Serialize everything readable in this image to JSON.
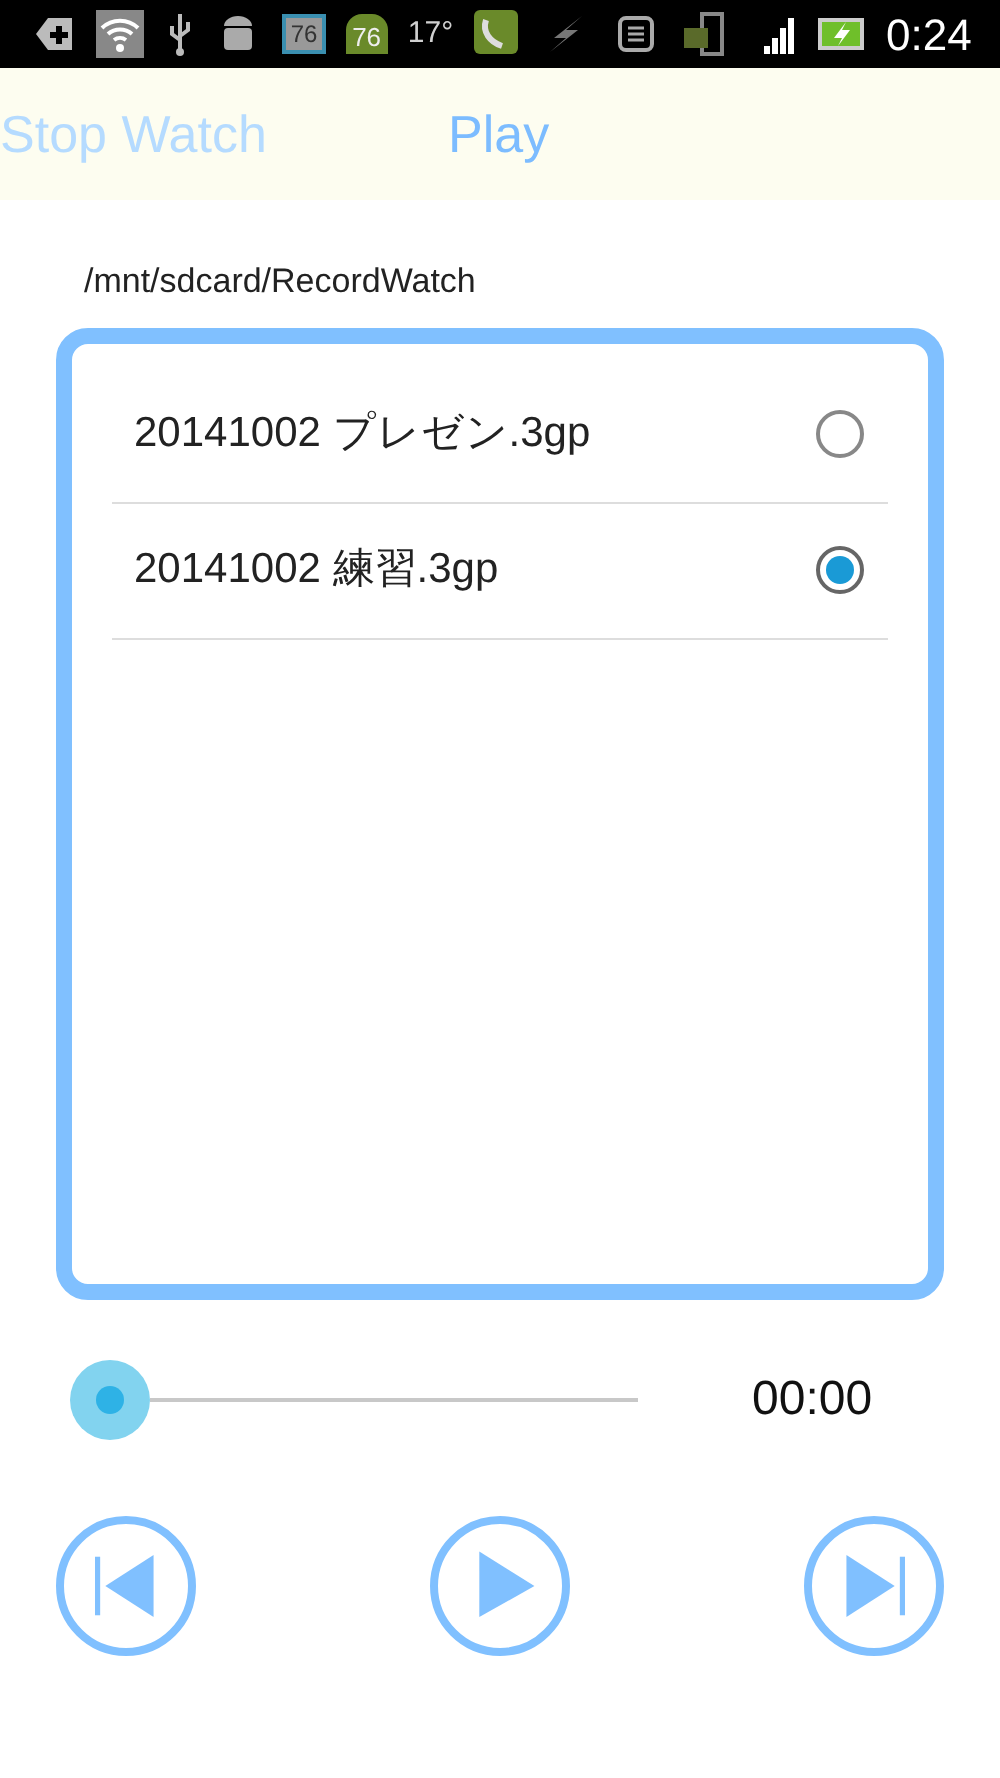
{
  "status_bar": {
    "battery_temp": "76",
    "cpu_temp": "76",
    "weather": "17°",
    "time": "0:24"
  },
  "tabs": [
    {
      "label": "Stop Watch",
      "selected": false
    },
    {
      "label": "Play",
      "selected": true
    }
  ],
  "path": "/mnt/sdcard/RecordWatch",
  "files": [
    {
      "name": "20141002 プレゼン.3gp",
      "selected": false
    },
    {
      "name": "20141002 練習.3gp",
      "selected": true
    }
  ],
  "player": {
    "time": "00:00"
  }
}
